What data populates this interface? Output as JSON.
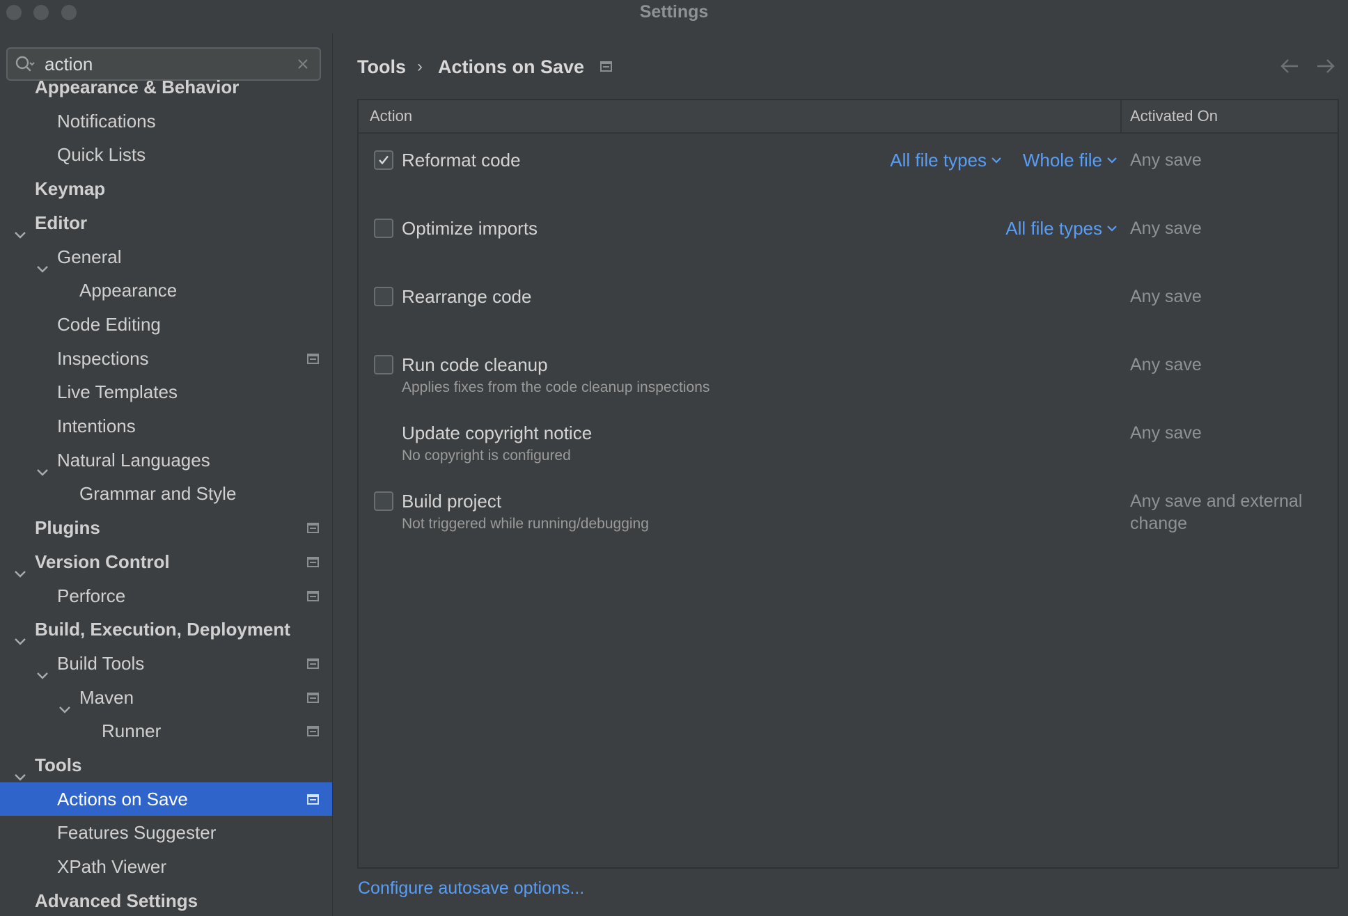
{
  "window": {
    "title": "Settings"
  },
  "search": {
    "value": "action"
  },
  "sidebar": {
    "items": [
      {
        "label": "Appearance & Behavior",
        "level": 0,
        "bold": true,
        "chevron": false,
        "proj": false,
        "selected": false
      },
      {
        "label": "Notifications",
        "level": 1,
        "bold": false,
        "chevron": false,
        "proj": false,
        "selected": false
      },
      {
        "label": "Quick Lists",
        "level": 1,
        "bold": false,
        "chevron": false,
        "proj": false,
        "selected": false
      },
      {
        "label": "Keymap",
        "level": 0,
        "bold": true,
        "chevron": false,
        "proj": false,
        "selected": false
      },
      {
        "label": "Editor",
        "level": 0,
        "bold": true,
        "chevron": true,
        "proj": false,
        "selected": false
      },
      {
        "label": "General",
        "level": 1,
        "bold": false,
        "chevron": true,
        "proj": false,
        "selected": false
      },
      {
        "label": "Appearance",
        "level": 2,
        "bold": false,
        "chevron": false,
        "proj": false,
        "selected": false
      },
      {
        "label": "Code Editing",
        "level": 1,
        "bold": false,
        "chevron": false,
        "proj": false,
        "selected": false
      },
      {
        "label": "Inspections",
        "level": 1,
        "bold": false,
        "chevron": false,
        "proj": true,
        "selected": false
      },
      {
        "label": "Live Templates",
        "level": 1,
        "bold": false,
        "chevron": false,
        "proj": false,
        "selected": false
      },
      {
        "label": "Intentions",
        "level": 1,
        "bold": false,
        "chevron": false,
        "proj": false,
        "selected": false
      },
      {
        "label": "Natural Languages",
        "level": 1,
        "bold": false,
        "chevron": true,
        "proj": false,
        "selected": false
      },
      {
        "label": "Grammar and Style",
        "level": 2,
        "bold": false,
        "chevron": false,
        "proj": false,
        "selected": false
      },
      {
        "label": "Plugins",
        "level": 0,
        "bold": true,
        "chevron": false,
        "proj": true,
        "selected": false
      },
      {
        "label": "Version Control",
        "level": 0,
        "bold": true,
        "chevron": true,
        "proj": true,
        "selected": false
      },
      {
        "label": "Perforce",
        "level": 1,
        "bold": false,
        "chevron": false,
        "proj": true,
        "selected": false
      },
      {
        "label": "Build, Execution, Deployment",
        "level": 0,
        "bold": true,
        "chevron": true,
        "proj": false,
        "selected": false
      },
      {
        "label": "Build Tools",
        "level": 1,
        "bold": false,
        "chevron": true,
        "proj": true,
        "selected": false
      },
      {
        "label": "Maven",
        "level": 2,
        "bold": false,
        "chevron": true,
        "proj": true,
        "selected": false
      },
      {
        "label": "Runner",
        "level": 3,
        "bold": false,
        "chevron": false,
        "proj": true,
        "selected": false
      },
      {
        "label": "Tools",
        "level": 0,
        "bold": true,
        "chevron": true,
        "proj": false,
        "selected": false
      },
      {
        "label": "Actions on Save",
        "level": 1,
        "bold": false,
        "chevron": false,
        "proj": true,
        "selected": true
      },
      {
        "label": "Features Suggester",
        "level": 1,
        "bold": false,
        "chevron": false,
        "proj": false,
        "selected": false
      },
      {
        "label": "XPath Viewer",
        "level": 1,
        "bold": false,
        "chevron": false,
        "proj": false,
        "selected": false
      },
      {
        "label": "Advanced Settings",
        "level": 0,
        "bold": true,
        "chevron": false,
        "proj": false,
        "selected": false
      }
    ]
  },
  "breadcrumb": {
    "parent": "Tools",
    "separator": "›",
    "current": "Actions on Save"
  },
  "table": {
    "columns": {
      "action": "Action",
      "activated": "Activated On"
    },
    "rows": [
      {
        "title": "Reformat code",
        "subtitle": "",
        "checkbox": true,
        "checked": true,
        "links": [
          "All file types",
          "Whole file"
        ],
        "activated": "Any save"
      },
      {
        "title": "Optimize imports",
        "subtitle": "",
        "checkbox": true,
        "checked": false,
        "links": [
          "All file types"
        ],
        "activated": "Any save"
      },
      {
        "title": "Rearrange code",
        "subtitle": "",
        "checkbox": true,
        "checked": false,
        "links": [],
        "activated": "Any save"
      },
      {
        "title": "Run code cleanup",
        "subtitle": "Applies fixes from the code cleanup inspections",
        "checkbox": true,
        "checked": false,
        "links": [],
        "activated": "Any save"
      },
      {
        "title": "Update copyright notice",
        "subtitle": "No copyright is configured",
        "checkbox": false,
        "checked": false,
        "links": [],
        "activated": "Any save"
      },
      {
        "title": "Build project",
        "subtitle": "Not triggered while running/debugging",
        "checkbox": true,
        "checked": false,
        "links": [],
        "activated": "Any save and external change"
      }
    ]
  },
  "footer": {
    "link": "Configure autosave options..."
  },
  "colors": {
    "selection": "#2f65ca",
    "link": "#589df6",
    "background": "#3c3f41"
  },
  "icons": {
    "search": "search-icon",
    "clear": "clear-icon",
    "project": "project-level-icon",
    "back": "arrow-left-icon",
    "forward": "arrow-right-icon"
  }
}
